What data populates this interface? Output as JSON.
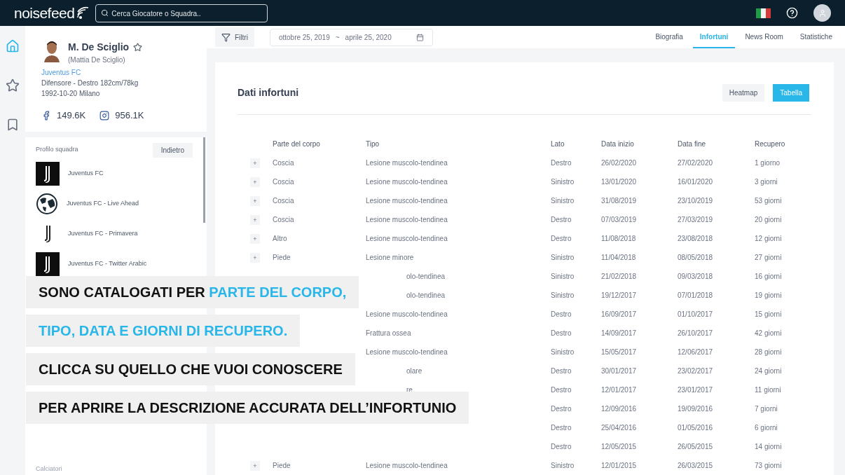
{
  "topbar": {
    "logo": "noisefeed",
    "search": {
      "placeholder": "Cerca Giocatore o Squadra.."
    }
  },
  "rail": [
    {
      "kind": "home",
      "selected": true
    },
    {
      "kind": "star",
      "selected": false
    },
    {
      "kind": "bookmark",
      "selected": false
    }
  ],
  "player": {
    "name": "M. De Sciglio",
    "full_name": "(Mattia De Sciglio)",
    "team": "Juventus FC",
    "role": "Difensore - Destro 182cm/78kg",
    "birth": "1992-10-20 Milano",
    "favorite": false,
    "social": [
      {
        "kind": "facebook",
        "count": "149.6K"
      },
      {
        "kind": "instagram",
        "count": "956.1K"
      }
    ]
  },
  "team_profile": {
    "label": "Profilo squadra",
    "back": "Indietro",
    "items": [
      {
        "kind": "logo-dark",
        "name": "Juventus FC"
      },
      {
        "kind": "globe",
        "name": "Juventus FC - Live Ahead"
      },
      {
        "kind": "logo-plain",
        "name": "Juventus FC - Primavera"
      },
      {
        "kind": "logo-dark",
        "name": "Juventus FC - Twitter Arabic"
      }
    ],
    "section": "Calciatori"
  },
  "toolbar": {
    "filter": "Filtri",
    "date_from": "ottobre 25, 2019",
    "date_sep": "~",
    "date_to": "aprile 25, 2020"
  },
  "tabs": [
    {
      "label": "Biografia",
      "selected": false
    },
    {
      "label": "Infortuni",
      "selected": true
    },
    {
      "label": "News Room",
      "selected": false
    },
    {
      "label": "Statistiche",
      "selected": false
    }
  ],
  "card": {
    "title": "Dati infortuni",
    "views": [
      {
        "label": "Heatmap",
        "selected": false
      },
      {
        "label": "Tabella",
        "selected": true
      }
    ]
  },
  "table": {
    "columns": [
      "Parte del corpo",
      "Tipo",
      "Lato",
      "Data inizio",
      "Data fine",
      "Recupero"
    ],
    "rows": [
      {
        "toggle": "+",
        "part": "Coscia",
        "type": "Lesione muscolo-tendinea",
        "side": "Destro",
        "start": "26/02/2020",
        "end": "27/02/2020",
        "recovery": "1 giorno"
      },
      {
        "toggle": "+",
        "part": "Coscia",
        "type": "Lesione muscolo-tendinea",
        "side": "Sinistro",
        "start": "13/01/2020",
        "end": "16/01/2020",
        "recovery": "3 giorni"
      },
      {
        "toggle": "+",
        "part": "Coscia",
        "type": "Lesione muscolo-tendinea",
        "side": "Sinistro",
        "start": "31/08/2019",
        "end": "23/10/2019",
        "recovery": "53 giorni"
      },
      {
        "toggle": "+",
        "part": "Coscia",
        "type": "Lesione muscolo-tendinea",
        "side": "Destro",
        "start": "07/03/2019",
        "end": "27/03/2019",
        "recovery": "20 giorni"
      },
      {
        "toggle": "+",
        "part": "Altro",
        "type": "Lesione muscolo-tendinea",
        "side": "Destro",
        "start": "11/08/2018",
        "end": "23/08/2018",
        "recovery": "12 giorni"
      },
      {
        "toggle": "+",
        "part": "Piede",
        "type": "Lesione minore",
        "side": "Sinistro",
        "start": "11/04/2018",
        "end": "08/05/2018",
        "recovery": "27 giorni"
      },
      {
        "type": "olo-tendinea",
        "type_cut": true,
        "side": "Sinistro",
        "start": "21/02/2018",
        "end": "09/03/2018",
        "recovery": "16 giorni"
      },
      {
        "type": "olo-tendinea",
        "type_cut": true,
        "side": "Sinistro",
        "start": "19/12/2017",
        "end": "07/01/2018",
        "recovery": "19 giorni"
      },
      {
        "type": "Lesione muscolo-tendinea",
        "side": "Destro",
        "start": "16/09/2017",
        "end": "01/10/2017",
        "recovery": "15 giorni"
      },
      {
        "type": "Frattura ossea",
        "side": "Destro",
        "start": "14/09/2017",
        "end": "26/10/2017",
        "recovery": "42 giorni"
      },
      {
        "type": "Lesione muscolo-tendinea",
        "side": "Sinistro",
        "start": "15/05/2017",
        "end": "12/06/2017",
        "recovery": "28 giorni"
      },
      {
        "type": "olare",
        "type_cut": true,
        "side": "Destro",
        "start": "30/01/2017",
        "end": "23/02/2017",
        "recovery": "24 giorni"
      },
      {
        "type": "re",
        "type_cut": true,
        "side": "Destro",
        "start": "12/01/2017",
        "end": "23/01/2017",
        "recovery": "11 giorni"
      },
      {
        "side": "Destro",
        "start": "12/09/2016",
        "end": "19/09/2016",
        "recovery": "7 giorni"
      },
      {
        "side": "Destro",
        "start": "25/04/2016",
        "end": "01/05/2016",
        "recovery": "6 giorni"
      },
      {
        "side": "Destro",
        "start": "12/05/2015",
        "end": "26/05/2015",
        "recovery": "14 giorni"
      },
      {
        "toggle": "+",
        "part": "Piede",
        "type": "Lesione muscolo-tendinea",
        "side": "Sinistro",
        "start": "12/01/2015",
        "end": "26/03/2015",
        "recovery": "73 giorni"
      }
    ]
  },
  "captions": [
    [
      {
        "text": "SONO CATALOGATI PER ",
        "highlight": false
      },
      {
        "text": "PARTE DEL CORPO,",
        "highlight": true
      }
    ],
    [
      {
        "text": "TIPO, DATA E GIORNI DI RECUPERO.",
        "highlight": true
      }
    ],
    [
      {
        "text": "CLICCA SU QUELLO CHE VUOI CONOSCERE",
        "highlight": false
      }
    ],
    [
      {
        "text": "PER APRIRE LA DESCRIZIONE ACCURATA DELL’INFORTUNIO",
        "highlight": false
      }
    ]
  ]
}
